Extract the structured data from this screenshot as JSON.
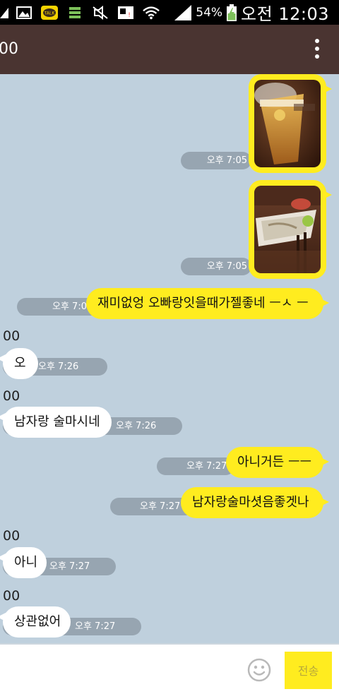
{
  "status_bar": {
    "battery": "54%",
    "time": "오전 12:03"
  },
  "header": {
    "title": "00",
    "menu_icon": "more-vertical-icon"
  },
  "messages": [
    {
      "type": "photo",
      "from": "me",
      "time": "오후 7:05",
      "image_desc": "beer"
    },
    {
      "type": "photo",
      "from": "me",
      "time": "오후 7:05",
      "image_desc": "food-dish"
    },
    {
      "type": "text",
      "from": "me",
      "time": "오후 7:06",
      "text": "재미없엉 오빠랑잇을때가젤좋네 ㅡㅅ ㅡ"
    },
    {
      "type": "text",
      "from": "them",
      "sender": "00",
      "time": "오후 7:26",
      "text": "오"
    },
    {
      "type": "text",
      "from": "them",
      "sender": "00",
      "time": "오후 7:26",
      "text": "남자랑 술마시네"
    },
    {
      "type": "text",
      "from": "me",
      "time": "오후 7:27",
      "text": "아니거든 ㅡㅡ"
    },
    {
      "type": "text",
      "from": "me",
      "time": "오후 7:27",
      "text": "남자랑술마셧음좋겟나"
    },
    {
      "type": "text",
      "from": "them",
      "sender": "00",
      "time": "오후 7:27",
      "text": "아니"
    },
    {
      "type": "text",
      "from": "them",
      "sender": "00",
      "time": "오후 7:27",
      "text": "상관없어"
    }
  ],
  "input_bar": {
    "placeholder": "",
    "send_label": "전송",
    "emoji_icon": "smiley-icon"
  },
  "colors": {
    "header_bg": "#4a3431",
    "chat_bg": "#bfd0dd",
    "my_bubble": "#ffec1f",
    "their_bubble": "#ffffff"
  }
}
